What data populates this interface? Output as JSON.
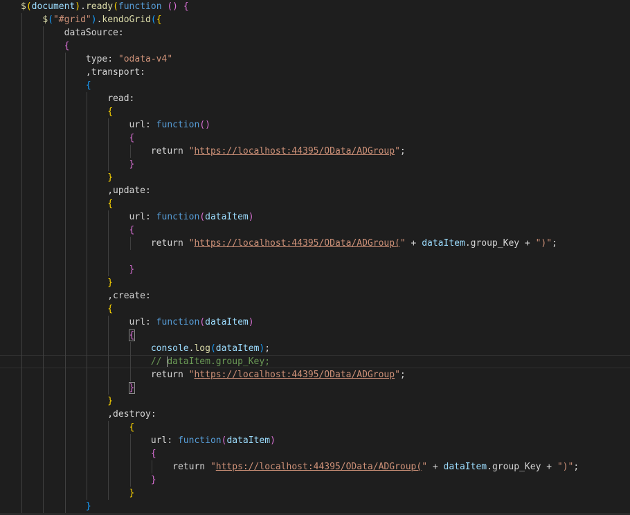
{
  "editor": {
    "language": "javascript",
    "theme_colors": {
      "background": "#1e1e1e",
      "keyword": "#569cd6",
      "string": "#ce9178",
      "variable": "#9cdcfe",
      "function": "#dcdcaa",
      "comment": "#6a9955",
      "bracket_level_1": "#ffd700",
      "bracket_level_2": "#da70d6",
      "bracket_level_3": "#179fff"
    },
    "cursor_line_number": 28,
    "lines": [
      [
        {
          "t": "$",
          "c": "t-fn"
        },
        {
          "t": "(",
          "c": "t-y"
        },
        {
          "t": "document",
          "c": "t-var"
        },
        {
          "t": ")",
          "c": "t-y"
        },
        {
          "t": ".",
          "c": "t-def"
        },
        {
          "t": "ready",
          "c": "t-fn"
        },
        {
          "t": "(",
          "c": "t-y"
        },
        {
          "t": "function",
          "c": "t-kw"
        },
        {
          "t": " ",
          "c": "t-def"
        },
        {
          "t": "()",
          "c": "t-p"
        },
        {
          "t": " ",
          "c": "t-def"
        },
        {
          "t": "{",
          "c": "t-p"
        }
      ],
      [
        {
          "t": "    ",
          "c": "t-def"
        },
        {
          "t": "$",
          "c": "t-fn"
        },
        {
          "t": "(",
          "c": "t-b"
        },
        {
          "t": "\"#grid\"",
          "c": "t-str"
        },
        {
          "t": ")",
          "c": "t-b"
        },
        {
          "t": ".",
          "c": "t-def"
        },
        {
          "t": "kendoGrid",
          "c": "t-fn"
        },
        {
          "t": "(",
          "c": "t-b"
        },
        {
          "t": "{",
          "c": "t-y"
        }
      ],
      [
        {
          "t": "        dataSource:",
          "c": "t-def"
        }
      ],
      [
        {
          "t": "        ",
          "c": "t-def"
        },
        {
          "t": "{",
          "c": "t-p"
        }
      ],
      [
        {
          "t": "            type: ",
          "c": "t-def"
        },
        {
          "t": "\"odata-v4\"",
          "c": "t-str"
        }
      ],
      [
        {
          "t": "            ,transport:",
          "c": "t-def"
        }
      ],
      [
        {
          "t": "            ",
          "c": "t-def"
        },
        {
          "t": "{",
          "c": "t-b"
        }
      ],
      [
        {
          "t": "                read:",
          "c": "t-def"
        }
      ],
      [
        {
          "t": "                ",
          "c": "t-def"
        },
        {
          "t": "{",
          "c": "t-y"
        }
      ],
      [
        {
          "t": "                    url: ",
          "c": "t-def"
        },
        {
          "t": "function",
          "c": "t-kw"
        },
        {
          "t": "()",
          "c": "t-p"
        }
      ],
      [
        {
          "t": "                    ",
          "c": "t-def"
        },
        {
          "t": "{",
          "c": "t-p"
        }
      ],
      [
        {
          "t": "                        return ",
          "c": "t-def"
        },
        {
          "t": "\"",
          "c": "t-str"
        },
        {
          "t": "https://localhost:44395/OData/ADGroup",
          "c": "t-url"
        },
        {
          "t": "\"",
          "c": "t-str"
        },
        {
          "t": ";",
          "c": "t-def"
        }
      ],
      [
        {
          "t": "                    ",
          "c": "t-def"
        },
        {
          "t": "}",
          "c": "t-p"
        }
      ],
      [
        {
          "t": "                ",
          "c": "t-def"
        },
        {
          "t": "}",
          "c": "t-y"
        }
      ],
      [
        {
          "t": "                ,update:",
          "c": "t-def"
        }
      ],
      [
        {
          "t": "                ",
          "c": "t-def"
        },
        {
          "t": "{",
          "c": "t-y"
        }
      ],
      [
        {
          "t": "                    url: ",
          "c": "t-def"
        },
        {
          "t": "function",
          "c": "t-kw"
        },
        {
          "t": "(",
          "c": "t-p"
        },
        {
          "t": "dataItem",
          "c": "t-var"
        },
        {
          "t": ")",
          "c": "t-p"
        }
      ],
      [
        {
          "t": "                    ",
          "c": "t-def"
        },
        {
          "t": "{",
          "c": "t-p"
        }
      ],
      [
        {
          "t": "                        return ",
          "c": "t-def"
        },
        {
          "t": "\"",
          "c": "t-str"
        },
        {
          "t": "https://localhost:44395/OData/ADGroup(",
          "c": "t-url"
        },
        {
          "t": "\"",
          "c": "t-str"
        },
        {
          "t": " + ",
          "c": "t-def"
        },
        {
          "t": "dataItem",
          "c": "t-var"
        },
        {
          "t": ".group_Key + ",
          "c": "t-def"
        },
        {
          "t": "\")\"",
          "c": "t-str"
        },
        {
          "t": ";",
          "c": "t-def"
        }
      ],
      [],
      [
        {
          "t": "                    ",
          "c": "t-def"
        },
        {
          "t": "}",
          "c": "t-p"
        }
      ],
      [
        {
          "t": "                ",
          "c": "t-def"
        },
        {
          "t": "}",
          "c": "t-y"
        }
      ],
      [
        {
          "t": "                ,create:",
          "c": "t-def"
        }
      ],
      [
        {
          "t": "                ",
          "c": "t-def"
        },
        {
          "t": "{",
          "c": "t-y"
        }
      ],
      [
        {
          "t": "                    url: ",
          "c": "t-def"
        },
        {
          "t": "function",
          "c": "t-kw"
        },
        {
          "t": "(",
          "c": "t-p"
        },
        {
          "t": "dataItem",
          "c": "t-var"
        },
        {
          "t": ")",
          "c": "t-p"
        }
      ],
      [
        {
          "t": "                    ",
          "c": "t-def"
        },
        {
          "t": "{",
          "c": "t-p bmatch"
        }
      ],
      [
        {
          "t": "                        ",
          "c": "t-def"
        },
        {
          "t": "console",
          "c": "t-var"
        },
        {
          "t": ".",
          "c": "t-def"
        },
        {
          "t": "log",
          "c": "t-fn"
        },
        {
          "t": "(",
          "c": "t-b"
        },
        {
          "t": "dataItem",
          "c": "t-var"
        },
        {
          "t": ")",
          "c": "t-b"
        },
        {
          "t": ";",
          "c": "t-def"
        }
      ],
      [
        {
          "t": "                        // ",
          "c": "t-com"
        },
        {
          "t": "",
          "c": "caret"
        },
        {
          "t": "dataItem.group_Key;",
          "c": "t-com"
        }
      ],
      [
        {
          "t": "                        return ",
          "c": "t-def"
        },
        {
          "t": "\"",
          "c": "t-str"
        },
        {
          "t": "https://localhost:44395/OData/ADGroup",
          "c": "t-url"
        },
        {
          "t": "\"",
          "c": "t-str"
        },
        {
          "t": ";",
          "c": "t-def"
        }
      ],
      [
        {
          "t": "                    ",
          "c": "t-def"
        },
        {
          "t": "}",
          "c": "t-p bmatch"
        }
      ],
      [
        {
          "t": "                ",
          "c": "t-def"
        },
        {
          "t": "}",
          "c": "t-y"
        }
      ],
      [
        {
          "t": "                ,destroy:",
          "c": "t-def"
        }
      ],
      [
        {
          "t": "                    ",
          "c": "t-def"
        },
        {
          "t": "{",
          "c": "t-y"
        }
      ],
      [
        {
          "t": "                        url: ",
          "c": "t-def"
        },
        {
          "t": "function",
          "c": "t-kw"
        },
        {
          "t": "(",
          "c": "t-p"
        },
        {
          "t": "dataItem",
          "c": "t-var"
        },
        {
          "t": ")",
          "c": "t-p"
        }
      ],
      [
        {
          "t": "                        ",
          "c": "t-def"
        },
        {
          "t": "{",
          "c": "t-p"
        }
      ],
      [
        {
          "t": "                            return ",
          "c": "t-def"
        },
        {
          "t": "\"",
          "c": "t-str"
        },
        {
          "t": "https://localhost:44395/OData/ADGroup(",
          "c": "t-url"
        },
        {
          "t": "\"",
          "c": "t-str"
        },
        {
          "t": " + ",
          "c": "t-def"
        },
        {
          "t": "dataItem",
          "c": "t-var"
        },
        {
          "t": ".group_Key + ",
          "c": "t-def"
        },
        {
          "t": "\")\"",
          "c": "t-str"
        },
        {
          "t": ";",
          "c": "t-def"
        }
      ],
      [
        {
          "t": "                        ",
          "c": "t-def"
        },
        {
          "t": "}",
          "c": "t-p"
        }
      ],
      [
        {
          "t": "                    ",
          "c": "t-def"
        },
        {
          "t": "}",
          "c": "t-y"
        }
      ],
      [
        {
          "t": "            ",
          "c": "t-def"
        },
        {
          "t": "}",
          "c": "t-b"
        }
      ]
    ]
  }
}
